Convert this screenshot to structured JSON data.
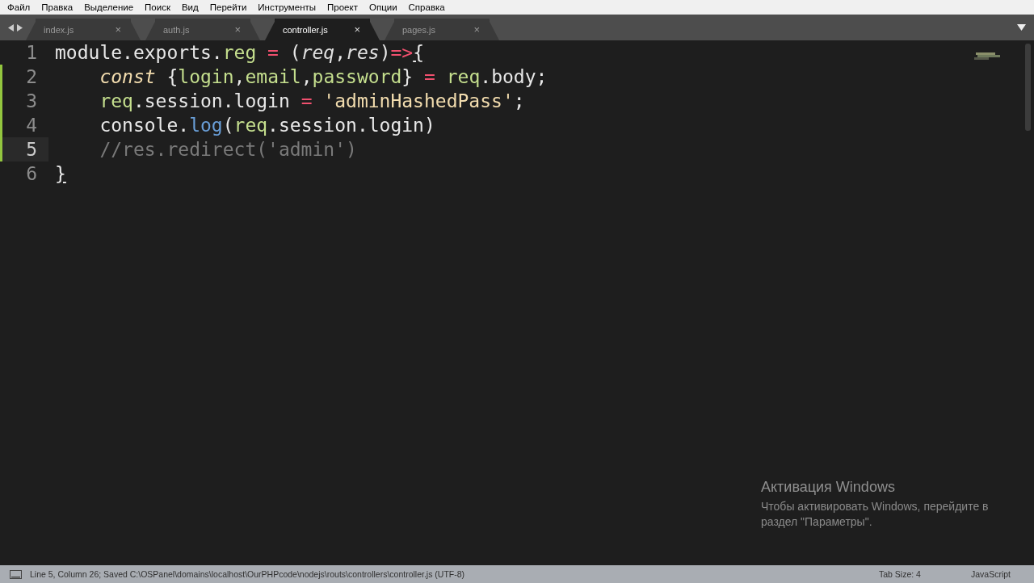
{
  "menu": [
    "Файл",
    "Правка",
    "Выделение",
    "Поиск",
    "Вид",
    "Перейти",
    "Инструменты",
    "Проект",
    "Опции",
    "Справка"
  ],
  "tabs": [
    {
      "label": "index.js",
      "selected": false,
      "close": "×"
    },
    {
      "label": "auth.js",
      "selected": false,
      "close": "×"
    },
    {
      "label": "controller.js",
      "selected": true,
      "close": "×"
    },
    {
      "label": "pages.js",
      "selected": false,
      "close": "×"
    }
  ],
  "editor": {
    "lines": [
      {
        "number": "1",
        "modified": false,
        "current": false,
        "indented": false,
        "tokens": [
          {
            "kind": "plain",
            "text": "module.exports."
          },
          {
            "kind": "name",
            "text": "reg"
          },
          {
            "kind": "operator",
            "text": " = "
          },
          {
            "kind": "plain",
            "text": "("
          },
          {
            "kind": "param",
            "text": "req"
          },
          {
            "kind": "plain",
            "text": ","
          },
          {
            "kind": "param",
            "text": "res"
          },
          {
            "kind": "plain",
            "text": ")"
          },
          {
            "kind": "operator",
            "text": "=>"
          },
          {
            "kind": "match",
            "text": "{"
          }
        ]
      },
      {
        "number": "2",
        "modified": true,
        "current": false,
        "indented": true,
        "tokens": [
          {
            "kind": "keyword",
            "text": "const"
          },
          {
            "kind": "plain",
            "text": " {"
          },
          {
            "kind": "name",
            "text": "login"
          },
          {
            "kind": "plain",
            "text": ","
          },
          {
            "kind": "name",
            "text": "email"
          },
          {
            "kind": "plain",
            "text": ","
          },
          {
            "kind": "name",
            "text": "password"
          },
          {
            "kind": "plain",
            "text": "} "
          },
          {
            "kind": "operator",
            "text": "= "
          },
          {
            "kind": "name",
            "text": "req"
          },
          {
            "kind": "plain",
            "text": ".body;"
          }
        ]
      },
      {
        "number": "3",
        "modified": true,
        "current": false,
        "indented": true,
        "tokens": [
          {
            "kind": "name",
            "text": "req"
          },
          {
            "kind": "plain",
            "text": ".session.login "
          },
          {
            "kind": "operator",
            "text": "= "
          },
          {
            "kind": "string",
            "text": "'adminHashedPass'"
          },
          {
            "kind": "plain",
            "text": ";"
          }
        ]
      },
      {
        "number": "4",
        "modified": true,
        "current": false,
        "indented": true,
        "tokens": [
          {
            "kind": "plain",
            "text": "console."
          },
          {
            "kind": "call",
            "text": "log"
          },
          {
            "kind": "plain",
            "text": "("
          },
          {
            "kind": "name",
            "text": "req"
          },
          {
            "kind": "plain",
            "text": ".session.login)"
          }
        ]
      },
      {
        "number": "5",
        "modified": true,
        "current": true,
        "indented": true,
        "tokens": [
          {
            "kind": "comment",
            "text": "//res.redirect('admin')"
          }
        ]
      },
      {
        "number": "6",
        "modified": false,
        "current": false,
        "indented": false,
        "tokens": [
          {
            "kind": "match",
            "text": "}"
          }
        ]
      }
    ]
  },
  "activation": {
    "title": "Активация Windows",
    "text": "Чтобы активировать Windows, перейдите в раздел \"Параметры\"."
  },
  "status_bar": {
    "message": "Line 5, Column 26; Saved C:\\OSPanel\\domains\\localhost\\OurPHPcode\\nodejs\\routs\\controllers\\controller.js (UTF-8)",
    "tab_size": "Tab Size: 4",
    "syntax": "JavaScript"
  }
}
